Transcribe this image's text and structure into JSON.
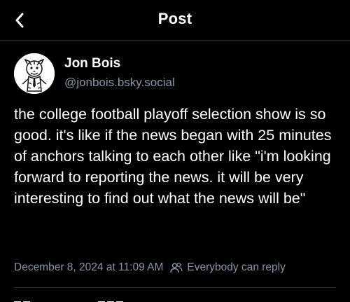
{
  "header": {
    "title": "Post"
  },
  "post": {
    "author": {
      "display_name": "Jon Bois",
      "handle": "@jonbois.bsky.social"
    },
    "text": "the college football playoff selection show is so good. it's like if the news began with 25 minutes of anchors talking to each other like \"i'm looking forward to reporting the news. it will be very interesting to find out what the news will be\"",
    "timestamp": "December 8, 2024 at 11:09 AM",
    "reply_setting": "Everybody can reply"
  },
  "icons": {
    "back": "chevron-left-icon",
    "reply_setting": "people-icon"
  },
  "colors": {
    "background": "#000000",
    "text": "#ffffff",
    "muted": "#8a94a3",
    "divider": "#2a2f36"
  }
}
